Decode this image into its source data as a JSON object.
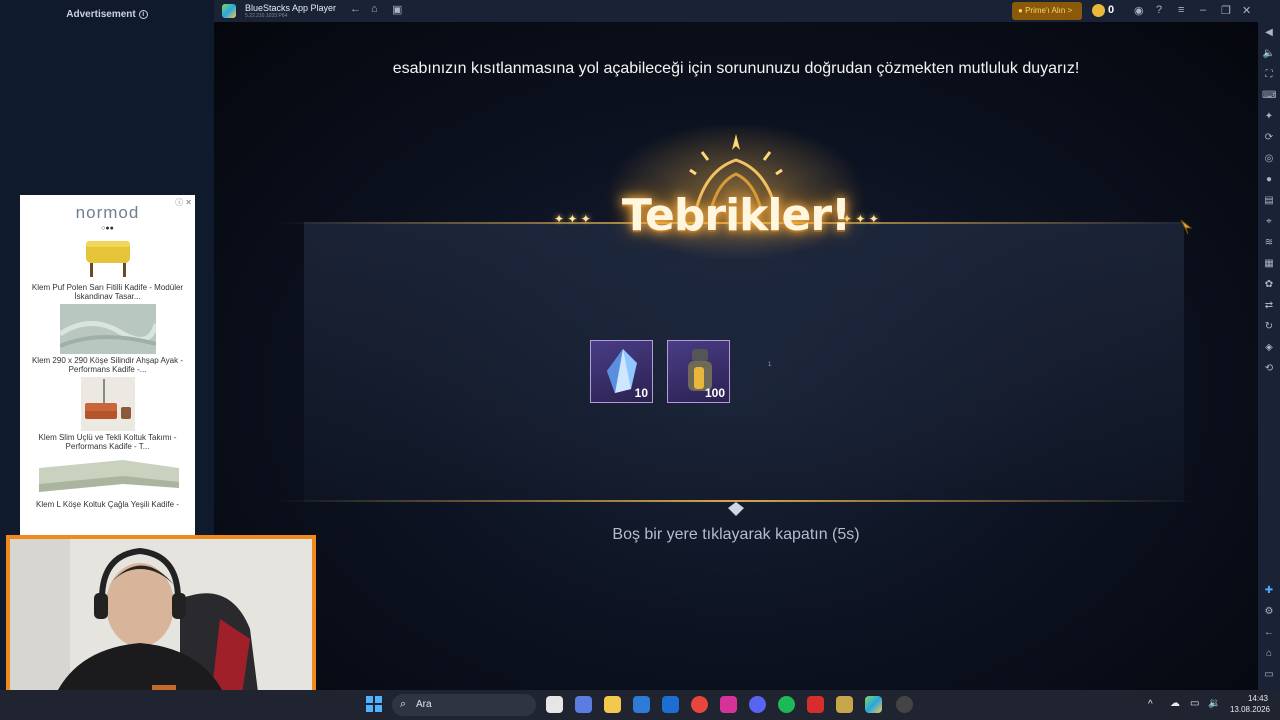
{
  "ad_column": {
    "label": "Advertisement",
    "brand": "normod",
    "dots": "○●●",
    "items": [
      {
        "title": "Klem Puf Polen Sarı Fitilli Kadife - Modüler İskandinav Tasar..."
      },
      {
        "title": "Klem 290 x 290 Köşe Silindir Ahşap Ayak - Performans Kadife -..."
      },
      {
        "title": "Klem Slim Uçlü ve Tekli Koltuk Takımı - Performans Kadife - T..."
      },
      {
        "title": "Klem L Köşe Koltuk Çağla Yeşili Kadife -"
      }
    ]
  },
  "window": {
    "title": "BlueStacks App Player",
    "subtitle": "5.22.210.1033 P64",
    "prime_label": "Prime'ı Alın >",
    "coins": "0"
  },
  "game": {
    "banner_text": "esabınızın kısıtlanmasına yol açabileceği için sorununuzu doğrudan çözmekten mutluluk duyarız!",
    "title": "Tebrikler!",
    "rewards": [
      {
        "name": "crystal",
        "count": "10"
      },
      {
        "name": "potion",
        "count": "100"
      }
    ],
    "tiny_marker": "1",
    "close_hint": "Boş bir yere tıklayarak kapatın (5s)"
  },
  "taskbar": {
    "search_placeholder": "Ara",
    "time": "14:43",
    "date": "13.08.2026"
  },
  "colors": {
    "accent_gold": "#d7a64a",
    "prime_bg": "#8a5a0a",
    "webcam_border": "#f08a1c"
  }
}
